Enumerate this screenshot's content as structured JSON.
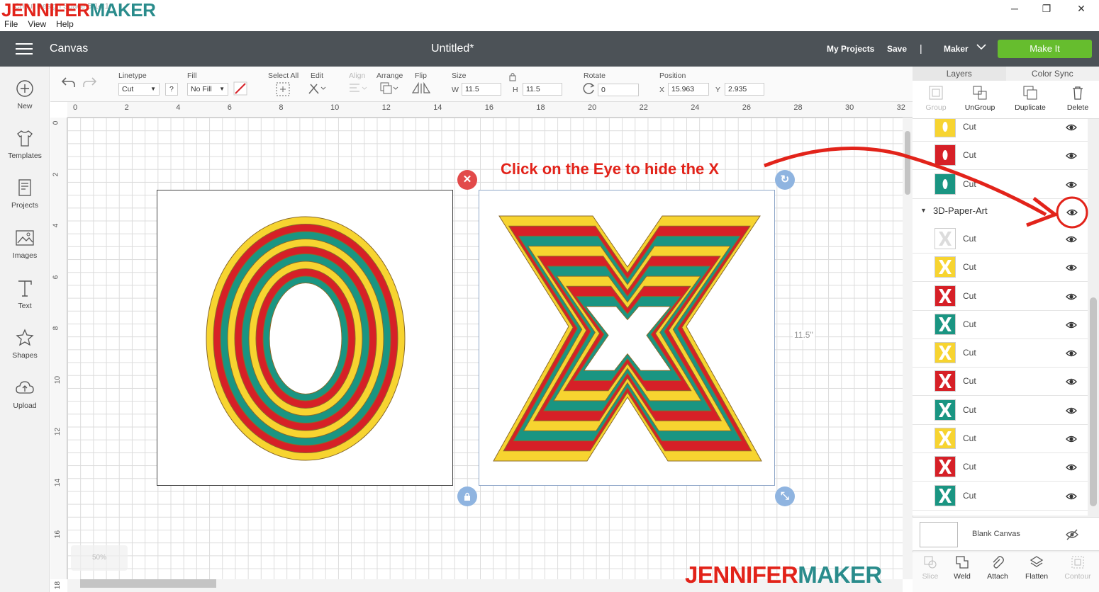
{
  "window": {
    "app_title": "Cricut Design Space 5.14.1",
    "menus": [
      "File",
      "View",
      "Help"
    ],
    "controls": {
      "minimize": "─",
      "restore": "❐",
      "close": "✕"
    }
  },
  "watermark": {
    "part_a": "JENNIFER",
    "part_b": "MAKER"
  },
  "header": {
    "section": "Canvas",
    "doc_title": "Untitled*",
    "my_projects": "My Projects",
    "save": "Save",
    "separator": "|",
    "machine": "Maker",
    "make_it": "Make It",
    "colors": {
      "header_bg": "#4c5257",
      "make_it_bg": "#66bd2e"
    }
  },
  "sidebar": {
    "items": [
      {
        "label": "New",
        "icon": "plus-circle-icon"
      },
      {
        "label": "Templates",
        "icon": "tshirt-icon"
      },
      {
        "label": "Projects",
        "icon": "projects-icon"
      },
      {
        "label": "Images",
        "icon": "image-icon"
      },
      {
        "label": "Text",
        "icon": "text-icon"
      },
      {
        "label": "Shapes",
        "icon": "shapes-icon"
      },
      {
        "label": "Upload",
        "icon": "cloud-upload-icon"
      }
    ]
  },
  "toolbar": {
    "linetype_label": "Linetype",
    "linetype_value": "Cut",
    "help_label": "?",
    "fill_label": "Fill",
    "fill_value": "No Fill",
    "select_all_label": "Select All",
    "edit_label": "Edit",
    "align_label": "Align",
    "arrange_label": "Arrange",
    "flip_label": "Flip",
    "size_label": "Size",
    "w_label": "W",
    "w_value": "11.5",
    "h_label": "H",
    "h_value": "11.5",
    "rotate_label": "Rotate",
    "rotate_value": "0",
    "position_label": "Position",
    "x_label": "X",
    "x_value": "15.963",
    "y_label": "Y",
    "y_value": "2.935"
  },
  "rulers": {
    "top": [
      "0",
      "2",
      "4",
      "6",
      "8",
      "10",
      "12",
      "14",
      "16",
      "18",
      "20",
      "22",
      "24",
      "26",
      "28",
      "30",
      "32"
    ],
    "left": [
      "0",
      "2",
      "4",
      "6",
      "8",
      "10",
      "12",
      "14",
      "16",
      "18"
    ]
  },
  "canvas": {
    "annotation": "Click on the Eye to hide the X",
    "size_label": "11.5\"",
    "zoom_text": "50%",
    "art_colors": {
      "yellow": "#f7d430",
      "red": "#d62027",
      "teal": "#1a9582",
      "outline": "#8a6a2a"
    }
  },
  "layers_panel": {
    "tabs": [
      "Layers",
      "Color Sync"
    ],
    "actions": [
      {
        "label": "Group",
        "enabled": false
      },
      {
        "label": "UnGroup",
        "enabled": true
      },
      {
        "label": "Duplicate",
        "enabled": true
      },
      {
        "label": "Delete",
        "enabled": true
      }
    ],
    "top_rows": [
      {
        "label": "Cut",
        "color": "#f7d430",
        "shape": "O"
      },
      {
        "label": "Cut",
        "color": "#d62027",
        "shape": "O"
      },
      {
        "label": "Cut",
        "color": "#1a9582",
        "shape": "O"
      }
    ],
    "group_name": "3D-Paper-Art",
    "group_rows": [
      {
        "label": "Cut",
        "color": "#ffffff"
      },
      {
        "label": "Cut",
        "color": "#f7d430"
      },
      {
        "label": "Cut",
        "color": "#d62027"
      },
      {
        "label": "Cut",
        "color": "#1a9582"
      },
      {
        "label": "Cut",
        "color": "#f7d430"
      },
      {
        "label": "Cut",
        "color": "#d62027"
      },
      {
        "label": "Cut",
        "color": "#1a9582"
      },
      {
        "label": "Cut",
        "color": "#f7d430"
      },
      {
        "label": "Cut",
        "color": "#d62027"
      },
      {
        "label": "Cut",
        "color": "#1a9582"
      }
    ],
    "blank_canvas": "Blank Canvas",
    "bottom_actions": [
      {
        "label": "Slice",
        "enabled": false
      },
      {
        "label": "Weld",
        "enabled": true
      },
      {
        "label": "Attach",
        "enabled": true
      },
      {
        "label": "Flatten",
        "enabled": true
      },
      {
        "label": "Contour",
        "enabled": false
      }
    ]
  }
}
